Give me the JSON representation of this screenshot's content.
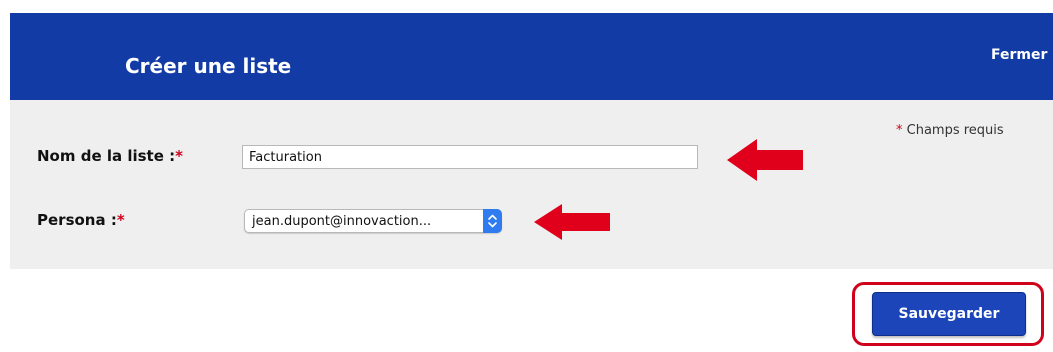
{
  "dialog": {
    "title": "Créer une liste",
    "close_label": "Fermer"
  },
  "form": {
    "required_note": {
      "star": "*",
      "text": " Champs requis"
    },
    "list_name": {
      "label": "Nom de la liste :",
      "star": "*",
      "value": "Facturation"
    },
    "persona": {
      "label": "Persona :",
      "star": "*",
      "selected": "jean.dupont@innovaction..."
    }
  },
  "footer": {
    "save_label": "Sauvegarder"
  },
  "colors": {
    "header_bg": "#123ba5",
    "panel_bg": "#efefef",
    "required_star": "#d0021b",
    "annotation_red": "#e0001b",
    "save_button_bg": "#1b45b8",
    "select_button_bg": "#2f7cf0"
  },
  "icons": {
    "select_toggle": "chevron-up-down-icon",
    "annotation": "red-arrow-left-icon"
  }
}
